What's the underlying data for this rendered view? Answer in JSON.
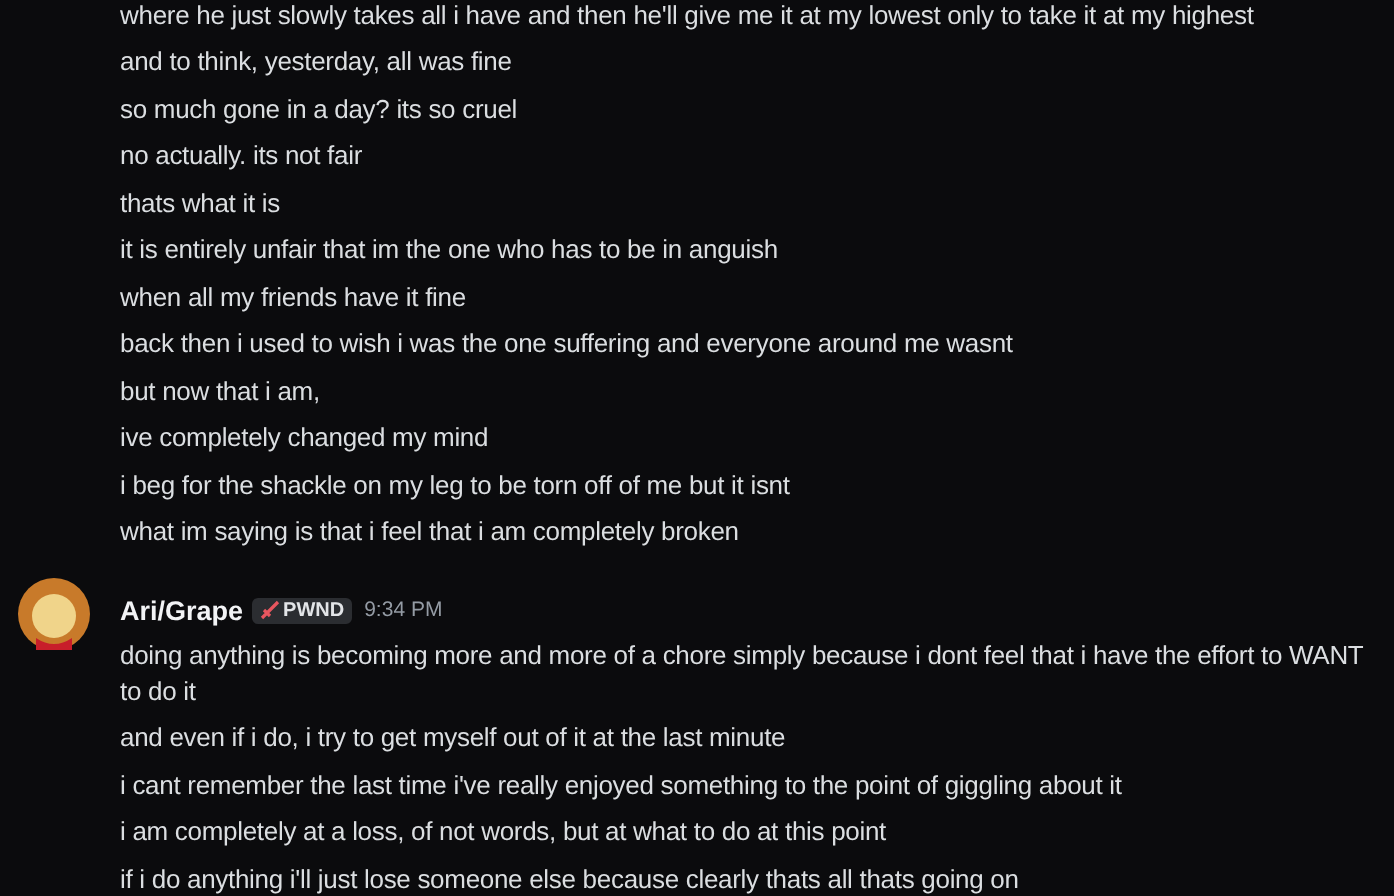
{
  "message_groups": [
    {
      "lines": [
        "where he just slowly takes all i have and then he'll give me it at my lowest only to take it at my highest",
        "and to think, yesterday, all was fine",
        "so much gone in a day? its so cruel",
        "no actually. its not fair",
        "thats what it is",
        "it is entirely unfair that im the one who has to be in anguish",
        "when all my friends have it fine",
        "back then i used to wish i was the one suffering and everyone around me wasnt",
        "but now that i am,",
        "ive completely changed my mind",
        "i beg for the shackle on my leg to be torn off of me but it isnt",
        "what im saying is that i feel that i am completely broken"
      ]
    },
    {
      "author": {
        "name": "Ari/Grape",
        "tag": "PWND",
        "time": "9:34 PM"
      },
      "lines": [
        "doing anything is becoming more and more of a chore simply because i dont feel that i have the effort to WANT to do it",
        "and even if i do, i try to get myself out of it at the last minute",
        "i cant remember the last time i've really enjoyed something to the point of giggling about it",
        "i am completely at a loss, of not words, but at what to do at this point",
        "if i do anything i'll just lose someone else because clearly thats all thats going on"
      ]
    }
  ]
}
